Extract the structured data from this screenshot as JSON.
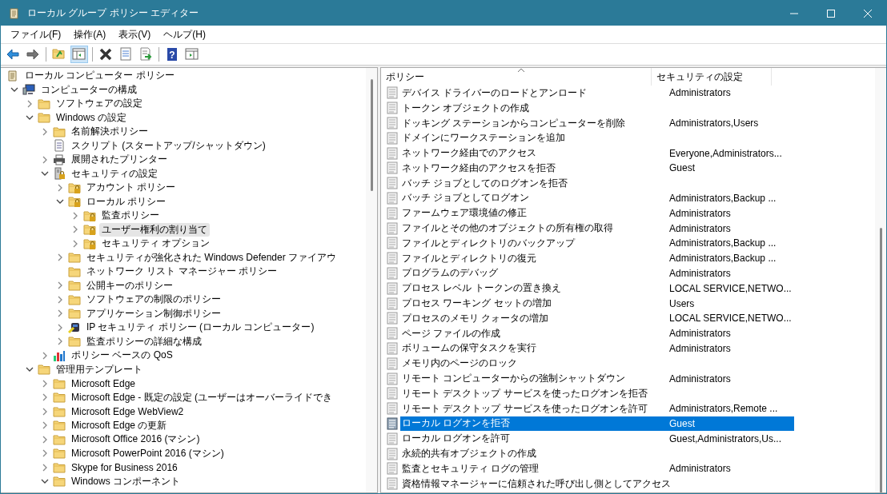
{
  "window": {
    "title": "ローカル グループ ポリシー エディター"
  },
  "menu": [
    "ファイル(F)",
    "操作(A)",
    "表示(V)",
    "ヘルプ(H)"
  ],
  "toolbar": [
    {
      "kind": "back",
      "pressed": false
    },
    {
      "kind": "forward",
      "pressed": false
    },
    {
      "kind": "sep"
    },
    {
      "kind": "up",
      "pressed": false
    },
    {
      "kind": "tree",
      "pressed": true
    },
    {
      "kind": "sep"
    },
    {
      "kind": "delete",
      "pressed": false
    },
    {
      "kind": "properties",
      "pressed": false
    },
    {
      "kind": "export",
      "pressed": false
    },
    {
      "kind": "sep"
    },
    {
      "kind": "help",
      "glyph": "?",
      "pressed": false
    },
    {
      "kind": "action",
      "pressed": false
    }
  ],
  "tree": [
    {
      "label": "ローカル コンピューター ポリシー",
      "kind": "doc",
      "selected": false,
      "children": [
        {
          "label": "コンピューターの構成",
          "kind": "computer",
          "expanded": true,
          "selected": false,
          "children": [
            {
              "label": "ソフトウェアの設定",
              "kind": "folder",
              "expanded": false,
              "selected": false
            },
            {
              "label": "Windows の設定",
              "kind": "folder",
              "expanded": true,
              "selected": false,
              "children": [
                {
                  "label": "名前解決ポリシー",
                  "kind": "folder",
                  "expanded": false,
                  "selected": false
                },
                {
                  "label": "スクリプト (スタートアップ/シャットダウン)",
                  "kind": "script",
                  "selected": false
                },
                {
                  "label": "展開されたプリンター",
                  "kind": "printer",
                  "expanded": false,
                  "selected": false
                },
                {
                  "label": "セキュリティの設定",
                  "kind": "security",
                  "expanded": true,
                  "selected": false,
                  "children": [
                    {
                      "label": "アカウント ポリシー",
                      "kind": "lockfolder",
                      "expanded": false,
                      "selected": false
                    },
                    {
                      "label": "ローカル ポリシー",
                      "kind": "lockfolder",
                      "expanded": true,
                      "selected": false,
                      "children": [
                        {
                          "label": "監査ポリシー",
                          "kind": "lockfolder",
                          "expanded": false,
                          "selected": false
                        },
                        {
                          "label": "ユーザー権利の割り当て",
                          "kind": "lockfolder",
                          "expanded": false,
                          "selected": true
                        },
                        {
                          "label": "セキュリティ オプション",
                          "kind": "lockfolder",
                          "expanded": false,
                          "selected": false
                        }
                      ]
                    },
                    {
                      "label": "セキュリティが強化された Windows Defender ファイアウ",
                      "kind": "folder",
                      "expanded": false,
                      "selected": false
                    },
                    {
                      "label": "ネットワーク リスト マネージャー ポリシー",
                      "kind": "folder",
                      "selected": false
                    },
                    {
                      "label": "公開キーのポリシー",
                      "kind": "folder",
                      "expanded": false,
                      "selected": false
                    },
                    {
                      "label": "ソフトウェアの制限のポリシー",
                      "kind": "folder",
                      "expanded": false,
                      "selected": false
                    },
                    {
                      "label": "アプリケーション制御ポリシー",
                      "kind": "folder",
                      "expanded": false,
                      "selected": false
                    },
                    {
                      "label": "IP セキュリティ ポリシー (ローカル コンピューター)",
                      "kind": "ipsec",
                      "expanded": false,
                      "selected": false
                    },
                    {
                      "label": "監査ポリシーの詳細な構成",
                      "kind": "folder",
                      "expanded": false,
                      "selected": false
                    }
                  ]
                },
                {
                  "label": "ポリシー ベースの QoS",
                  "kind": "qos",
                  "expanded": false,
                  "selected": false
                }
              ]
            },
            {
              "label": "管理用テンプレート",
              "kind": "folder",
              "expanded": true,
              "selected": false,
              "children": [
                {
                  "label": "Microsoft Edge",
                  "kind": "folder",
                  "expanded": false,
                  "selected": false
                },
                {
                  "label": "Microsoft Edge - 既定の設定 (ユーザーはオーバーライドでき",
                  "kind": "folder",
                  "expanded": false,
                  "selected": false
                },
                {
                  "label": "Microsoft Edge WebView2",
                  "kind": "folder",
                  "expanded": false,
                  "selected": false
                },
                {
                  "label": "Microsoft Edge の更新",
                  "kind": "folder",
                  "expanded": false,
                  "selected": false
                },
                {
                  "label": "Microsoft Office 2016 (マシン)",
                  "kind": "folder",
                  "expanded": false,
                  "selected": false
                },
                {
                  "label": "Microsoft PowerPoint 2016 (マシン)",
                  "kind": "folder",
                  "expanded": false,
                  "selected": false
                },
                {
                  "label": "Skype for Business 2016",
                  "kind": "folder",
                  "expanded": false,
                  "selected": false
                },
                {
                  "label": "Windows コンポーネント",
                  "kind": "folder",
                  "expanded": true,
                  "selected": false
                }
              ]
            }
          ]
        }
      ]
    }
  ],
  "table": {
    "columns": [
      "ポリシー",
      "セキュリティの設定"
    ],
    "rows": [
      {
        "policy": "デバイス ドライバーのロードとアンロード",
        "setting": "Administrators",
        "selected": false
      },
      {
        "policy": "トークン オブジェクトの作成",
        "selected": false
      },
      {
        "policy": "ドッキング ステーションからコンピューターを削除",
        "setting": "Administrators,Users",
        "selected": false
      },
      {
        "policy": "ドメインにワークステーションを追加",
        "selected": false
      },
      {
        "policy": "ネットワーク経由でのアクセス",
        "setting": "Everyone,Administrators...",
        "selected": false
      },
      {
        "policy": "ネットワーク経由のアクセスを拒否",
        "setting": "Guest",
        "selected": false
      },
      {
        "policy": "バッチ ジョブとしてのログオンを拒否",
        "selected": false
      },
      {
        "policy": "バッチ ジョブとしてログオン",
        "setting": "Administrators,Backup ...",
        "selected": false
      },
      {
        "policy": "ファームウェア環境値の修正",
        "setting": "Administrators",
        "selected": false
      },
      {
        "policy": "ファイルとその他のオブジェクトの所有権の取得",
        "setting": "Administrators",
        "selected": false
      },
      {
        "policy": "ファイルとディレクトリのバックアップ",
        "setting": "Administrators,Backup ...",
        "selected": false
      },
      {
        "policy": "ファイルとディレクトリの復元",
        "setting": "Administrators,Backup ...",
        "selected": false
      },
      {
        "policy": "プログラムのデバッグ",
        "setting": "Administrators",
        "selected": false
      },
      {
        "policy": "プロセス レベル トークンの置き換え",
        "setting": "LOCAL SERVICE,NETWO...",
        "selected": false
      },
      {
        "policy": "プロセス ワーキング セットの増加",
        "setting": "Users",
        "selected": false
      },
      {
        "policy": "プロセスのメモリ クォータの増加",
        "setting": "LOCAL SERVICE,NETWO...",
        "selected": false
      },
      {
        "policy": "ページ ファイルの作成",
        "setting": "Administrators",
        "selected": false
      },
      {
        "policy": "ボリュームの保守タスクを実行",
        "setting": "Administrators",
        "selected": false
      },
      {
        "policy": "メモリ内のページのロック",
        "selected": false
      },
      {
        "policy": "リモート コンピューターからの強制シャットダウン",
        "setting": "Administrators",
        "selected": false
      },
      {
        "policy": "リモート デスクトップ サービスを使ったログオンを拒否",
        "selected": false
      },
      {
        "policy": "リモート デスクトップ サービスを使ったログオンを許可",
        "setting": "Administrators,Remote ...",
        "selected": false
      },
      {
        "policy": "ローカル ログオンを拒否",
        "setting": "Guest",
        "selected": true
      },
      {
        "policy": "ローカル ログオンを許可",
        "setting": "Guest,Administrators,Us...",
        "selected": false
      },
      {
        "policy": "永続的共有オブジェクトの作成",
        "selected": false
      },
      {
        "policy": "監査とセキュリティ ログの管理",
        "setting": "Administrators",
        "selected": false
      },
      {
        "policy": "資格情報マネージャーに信頼された呼び出し側としてアクセス",
        "selected": false
      }
    ]
  }
}
